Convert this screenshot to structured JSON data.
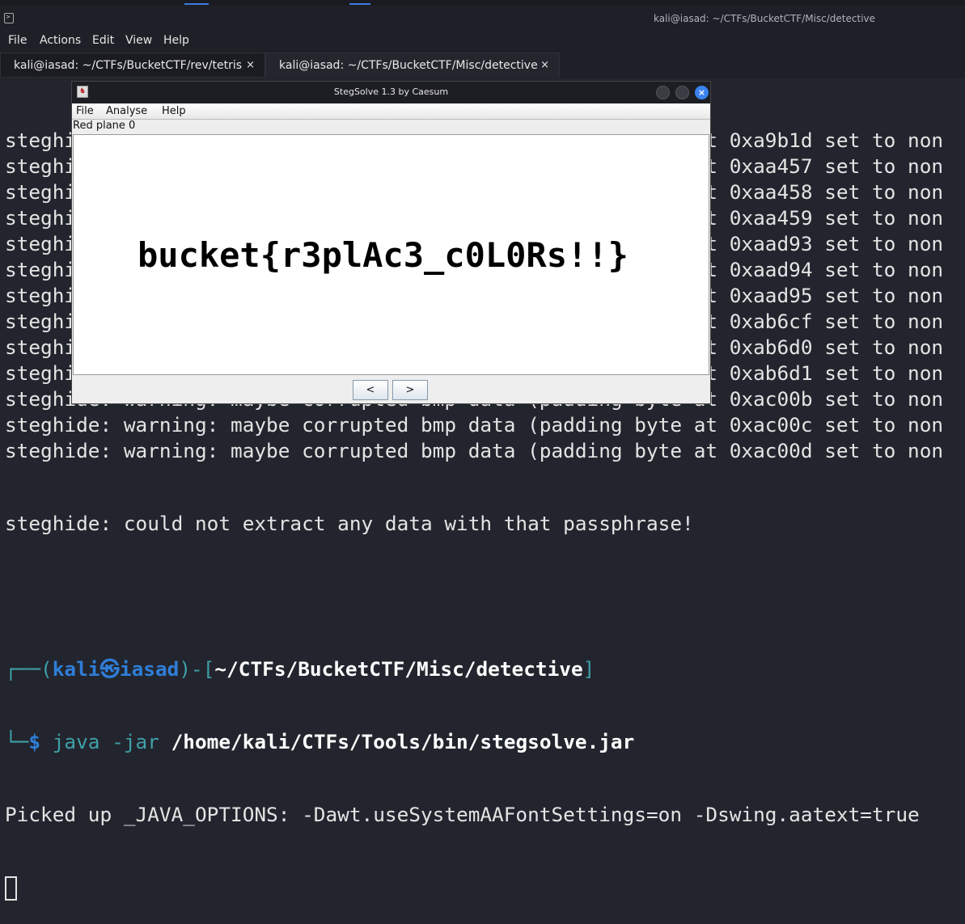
{
  "window": {
    "title": "kali@iasad: ~/CTFs/BucketCTF/Misc/detective"
  },
  "menu": [
    "File",
    "Actions",
    "Edit",
    "View",
    "Help"
  ],
  "tabs": [
    {
      "label": "kali@iasad: ~/CTFs/BucketCTF/rev/tetris",
      "close": "×"
    },
    {
      "label": "kali@iasad: ~/CTFs/BucketCTF/Misc/detective",
      "close": "×"
    }
  ],
  "terminal": {
    "warnings": [
      "steghide: warning: maybe corrupted bmp data (padding byte at 0xa9b1d set to non",
      "steghide: warning: maybe corrupted bmp data (padding byte at 0xaa457 set to non",
      "steghide: warning: maybe corrupted bmp data (padding byte at 0xaa458 set to non",
      "steghide: warning: maybe corrupted bmp data (padding byte at 0xaa459 set to non",
      "steghide: warning: maybe corrupted bmp data (padding byte at 0xaad93 set to non",
      "steghide: warning: maybe corrupted bmp data (padding byte at 0xaad94 set to non",
      "steghide: warning: maybe corrupted bmp data (padding byte at 0xaad95 set to non",
      "steghide: warning: maybe corrupted bmp data (padding byte at 0xab6cf set to non",
      "steghide: warning: maybe corrupted bmp data (padding byte at 0xab6d0 set to non",
      "steghide: warning: maybe corrupted bmp data (padding byte at 0xab6d1 set to non",
      "steghide: warning: maybe corrupted bmp data (padding byte at 0xac00b set to non",
      "steghide: warning: maybe corrupted bmp data (padding byte at 0xac00c set to non",
      "steghide: warning: maybe corrupted bmp data (padding byte at 0xac00d set to non"
    ],
    "error": "steghide: could not extract any data with that passphrase!",
    "prompt": {
      "user": "kali",
      "host": "iasad",
      "path": "~/CTFs/BucketCTF/Misc/detective",
      "symbol": "$"
    },
    "command": {
      "prog": "java -jar",
      "arg": "/home/kali/CTFs/Tools/bin/stegsolve.jar"
    },
    "output": "Picked up _JAVA_OPTIONS: -Dawt.useSystemAAFontSettings=on -Dswing.aatext=true"
  },
  "stegsolve": {
    "title": "StegSolve 1.3 by Caesum",
    "menu": [
      "File",
      "Analyse",
      "Help"
    ],
    "plane": "Red plane 0",
    "flag": "bucket{r3plAc3_c0L0Rs!!}",
    "prev": "<",
    "next": ">"
  }
}
